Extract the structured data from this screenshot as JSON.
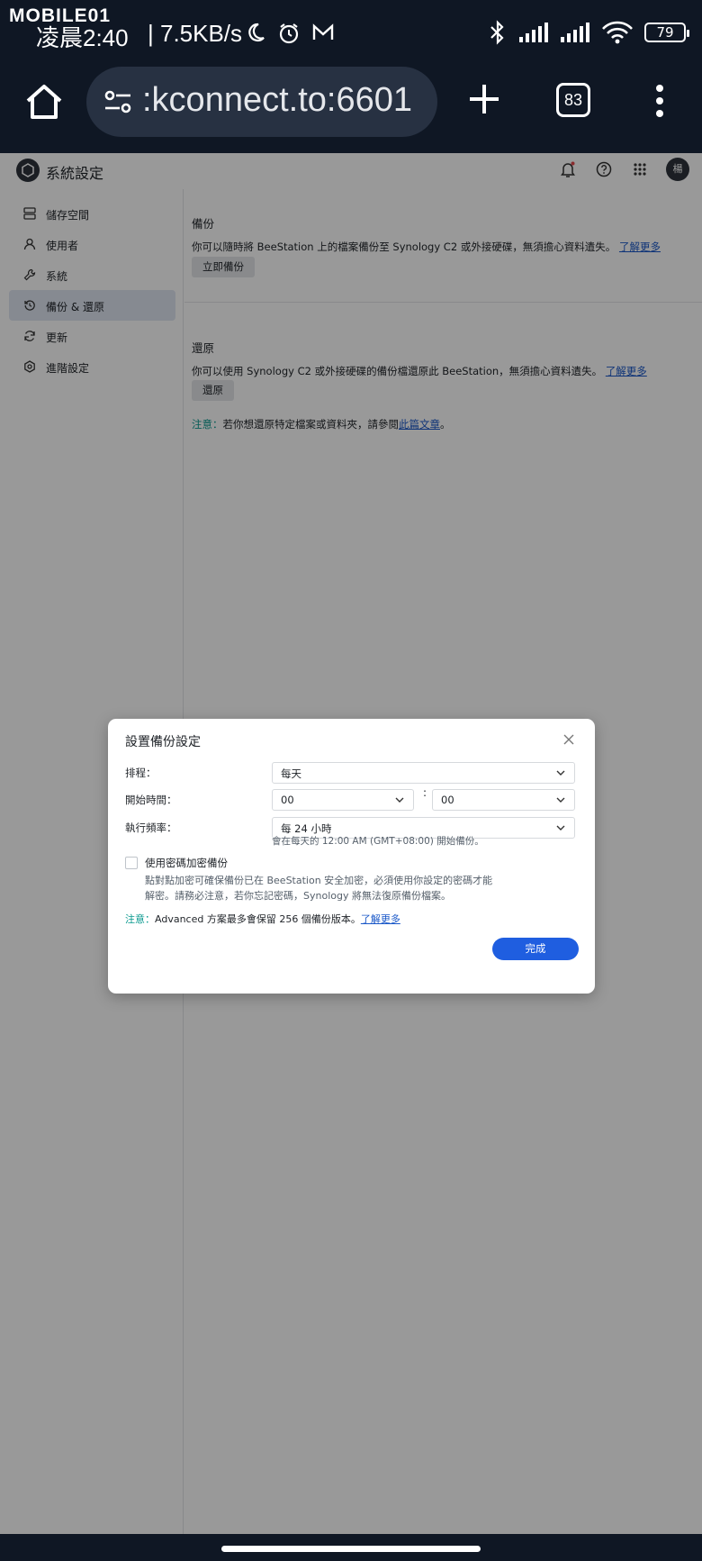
{
  "status_bar": {
    "brand": "MOBILE01",
    "time": "凌晨2:40",
    "speed": "| 7.5KB/s",
    "battery": "79"
  },
  "browser": {
    "url": ":kconnect.to:6601",
    "tab_count": "83"
  },
  "app": {
    "title": "系統設定",
    "avatar_initial": "楊"
  },
  "sidebar": {
    "items": [
      {
        "label": "儲存空間",
        "icon": "storage-icon"
      },
      {
        "label": "使用者",
        "icon": "user-icon"
      },
      {
        "label": "系統",
        "icon": "wrench-icon"
      },
      {
        "label": "備份 & 還原",
        "icon": "backup-restore-icon",
        "active": true
      },
      {
        "label": "更新",
        "icon": "refresh-icon"
      },
      {
        "label": "進階設定",
        "icon": "advanced-settings-icon"
      }
    ]
  },
  "backup_section": {
    "title": "備份",
    "description": "你可以隨時將 BeeStation 上的檔案備份至 Synology C2 或外接硬碟，無須擔心資料遺失。",
    "learn_more": "了解更多",
    "button": "立即備份"
  },
  "restore_section": {
    "title": "還原",
    "description": "你可以使用 Synology C2 或外接硬碟的備份檔還原此 BeeStation，無須擔心資料遺失。",
    "learn_more": "了解更多",
    "button": "還原",
    "note_label": "注意：",
    "note_text": "若你想還原特定檔案或資料夾，請參閱",
    "note_link": "此篇文章",
    "note_end": "。"
  },
  "modal": {
    "title": "設置備份設定",
    "schedule_label": "排程：",
    "schedule_value": "每天",
    "start_time_label": "開始時間：",
    "start_hour": "00",
    "colon": ":",
    "start_minute": "00",
    "frequency_label": "執行頻率：",
    "frequency_value": "每 24 小時",
    "hint": "會在每天的 12:00 AM (GMT+08:00) 開始備份。",
    "encrypt_label": "使用密碼加密備份",
    "encrypt_desc": "點對點加密可確保備份已在 BeeStation 安全加密，必須使用你設定的密碼才能解密。請務必注意，若你忘記密碼，Synology 將無法復原備份檔案。",
    "note_label": "注意：",
    "note_text": "Advanced 方案最多會保留 256 個備份版本。",
    "note_link": "了解更多",
    "done_button": "完成"
  }
}
